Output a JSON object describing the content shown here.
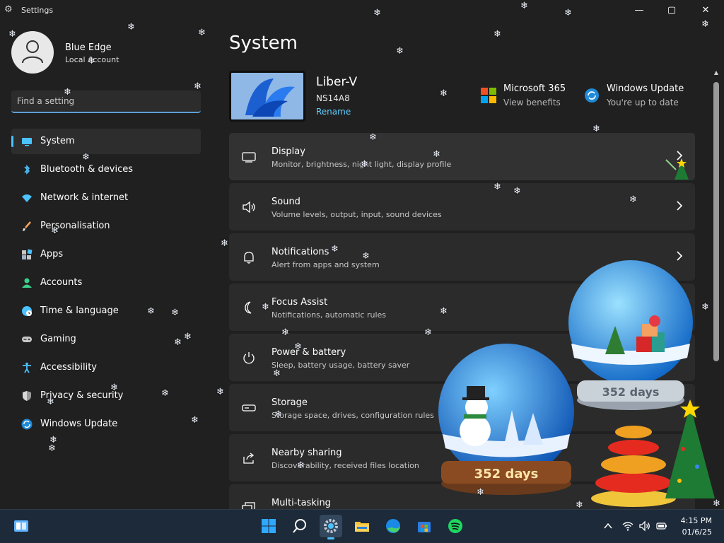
{
  "window": {
    "title": "Settings",
    "controls": {
      "minimize": "—",
      "maximize": "▢",
      "close": "✕"
    }
  },
  "user": {
    "name": "Blue Edge",
    "account_type": "Local Account"
  },
  "search": {
    "placeholder": "Find a setting",
    "value": ""
  },
  "sidebar": {
    "items": [
      {
        "label": "System",
        "icon": "system-icon",
        "active": true
      },
      {
        "label": "Bluetooth & devices",
        "icon": "bluetooth-icon"
      },
      {
        "label": "Network & internet",
        "icon": "wifi-icon"
      },
      {
        "label": "Personalisation",
        "icon": "brush-icon"
      },
      {
        "label": "Apps",
        "icon": "apps-icon"
      },
      {
        "label": "Accounts",
        "icon": "person-icon"
      },
      {
        "label": "Time & language",
        "icon": "globe-clock-icon"
      },
      {
        "label": "Gaming",
        "icon": "gamepad-icon"
      },
      {
        "label": "Accessibility",
        "icon": "accessibility-icon"
      },
      {
        "label": "Privacy & security",
        "icon": "shield-icon"
      },
      {
        "label": "Windows Update",
        "icon": "update-icon"
      }
    ]
  },
  "main": {
    "title": "System",
    "device": {
      "name": "Liber-V",
      "model": "NS14A8",
      "rename_label": "Rename"
    },
    "quick_links": [
      {
        "title": "Microsoft 365",
        "subtitle": "View benefits",
        "icon": "microsoft-logo-icon"
      },
      {
        "title": "Windows Update",
        "subtitle": "You're up to date",
        "icon": "refresh-icon"
      }
    ],
    "cards": [
      {
        "title": "Display",
        "subtitle": "Monitor, brightness, night light, display profile",
        "icon": "monitor-icon"
      },
      {
        "title": "Sound",
        "subtitle": "Volume levels, output, input, sound devices",
        "icon": "speaker-icon"
      },
      {
        "title": "Notifications",
        "subtitle": "Alert from apps and system",
        "icon": "bell-icon"
      },
      {
        "title": "Focus Assist",
        "subtitle": "Notifications, automatic rules",
        "icon": "moon-icon"
      },
      {
        "title": "Power & battery",
        "subtitle": "Sleep, battery usage, battery saver",
        "icon": "power-icon"
      },
      {
        "title": "Storage",
        "subtitle": "Storage space, drives, configuration rules",
        "icon": "drive-icon"
      },
      {
        "title": "Nearby sharing",
        "subtitle": "Discoverability, received files location",
        "icon": "share-icon"
      },
      {
        "title": "Multi-tasking",
        "subtitle": "",
        "icon": "multitask-icon"
      }
    ]
  },
  "decorations": {
    "globe_left_days": "352 days",
    "globe_right_days": "352 days"
  },
  "taskbar": {
    "apps": [
      "widgets-icon",
      "start-icon",
      "search-icon",
      "settings-icon",
      "file-explorer-icon",
      "edge-icon",
      "store-icon",
      "spotify-icon"
    ],
    "tray": [
      "chevron-up-icon",
      "wifi-icon",
      "volume-icon",
      "battery-icon"
    ],
    "time": "4:15 PM",
    "date": "01/6/25"
  },
  "colors": {
    "accent": "#4cc2ff",
    "link": "#60cdff",
    "background": "#202020",
    "card": "#2b2b2b",
    "taskbar": "#1c2a3a"
  }
}
